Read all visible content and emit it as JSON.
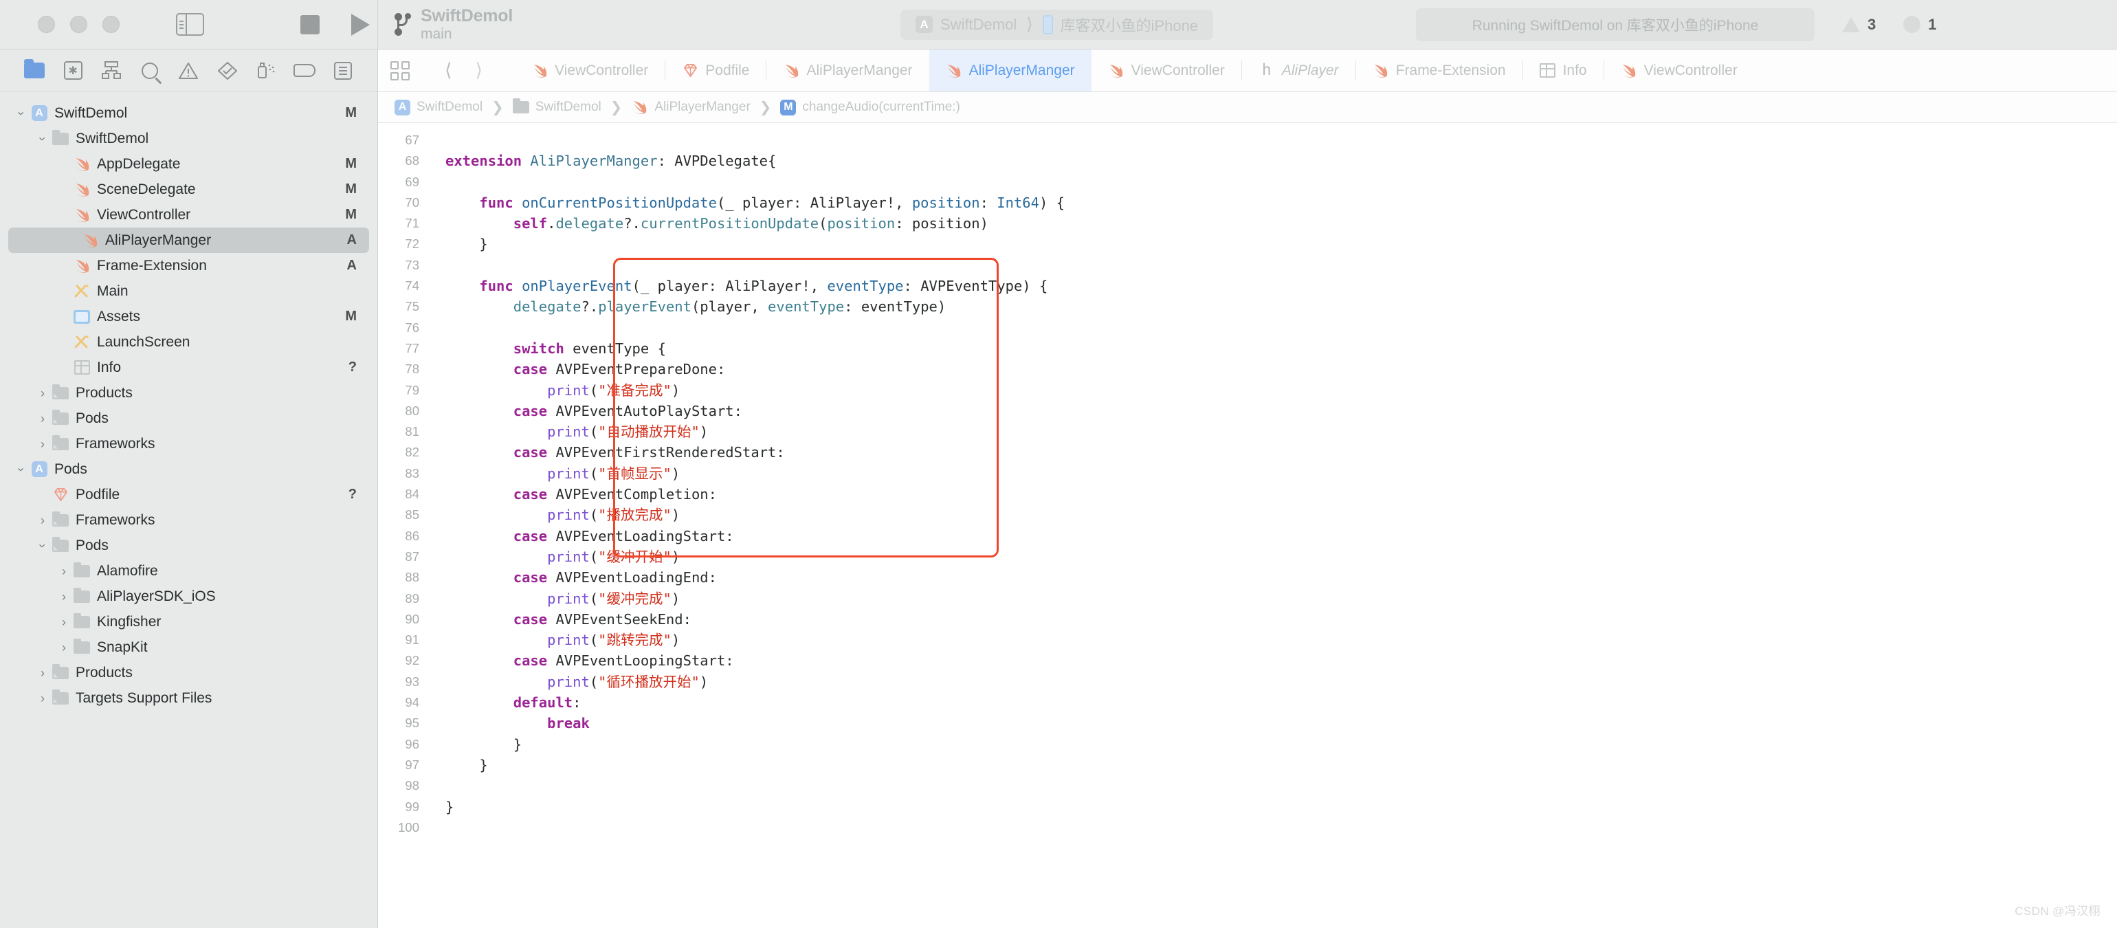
{
  "titlebar": {
    "project_name": "SwiftDemol",
    "branch": "main",
    "scheme_target": "SwiftDemol",
    "scheme_device": "库客双小鱼的iPhone",
    "status": "Running SwiftDemol on 库客双小鱼的iPhone",
    "warning_count": "3",
    "error_count": "1",
    "app_glyph": "A",
    "run_icon": "play-icon",
    "stop_icon": "stop-icon",
    "sidebar_icon": "sidebar-toggle-icon"
  },
  "navigator": {
    "toolbar_icons": [
      "project-navigator-icon",
      "source-control-navigator-icon",
      "symbol-navigator-icon",
      "find-navigator-icon",
      "issue-navigator-icon",
      "test-navigator-icon",
      "debug-navigator-icon",
      "breakpoint-navigator-icon",
      "report-navigator-icon"
    ],
    "items": [
      {
        "label": "SwiftDemol",
        "icon": "appstore-icon",
        "indent": 0,
        "twisty": "down",
        "mark": "M"
      },
      {
        "label": "SwiftDemol",
        "icon": "folder-icon",
        "indent": 1,
        "twisty": "down",
        "mark": ""
      },
      {
        "label": "AppDelegate",
        "icon": "swift-icon",
        "indent": 2,
        "twisty": "",
        "mark": "M"
      },
      {
        "label": "SceneDelegate",
        "icon": "swift-icon",
        "indent": 2,
        "twisty": "",
        "mark": "M"
      },
      {
        "label": "ViewController",
        "icon": "swift-icon",
        "indent": 2,
        "twisty": "",
        "mark": "M"
      },
      {
        "label": "AliPlayerManger",
        "icon": "swift-icon",
        "indent": 2,
        "twisty": "",
        "mark": "A",
        "selected": true
      },
      {
        "label": "Frame-Extension",
        "icon": "swift-icon",
        "indent": 2,
        "twisty": "",
        "mark": "A"
      },
      {
        "label": "Main",
        "icon": "storyboard-icon",
        "indent": 2,
        "twisty": "",
        "mark": ""
      },
      {
        "label": "Assets",
        "icon": "assets-icon",
        "indent": 2,
        "twisty": "",
        "mark": "M"
      },
      {
        "label": "LaunchScreen",
        "icon": "storyboard-icon",
        "indent": 2,
        "twisty": "",
        "mark": ""
      },
      {
        "label": "Info",
        "icon": "plist-icon",
        "indent": 2,
        "twisty": "",
        "mark": "?"
      },
      {
        "label": "Products",
        "icon": "folder-group-icon",
        "indent": 1,
        "twisty": "right",
        "mark": ""
      },
      {
        "label": "Pods",
        "icon": "folder-group-icon",
        "indent": 1,
        "twisty": "right",
        "mark": ""
      },
      {
        "label": "Frameworks",
        "icon": "folder-group-icon",
        "indent": 1,
        "twisty": "right",
        "mark": ""
      },
      {
        "label": "Pods",
        "icon": "appstore-icon",
        "indent": 0,
        "twisty": "down",
        "mark": ""
      },
      {
        "label": "Podfile",
        "icon": "ruby-icon",
        "indent": 1,
        "twisty": "",
        "mark": "?"
      },
      {
        "label": "Frameworks",
        "icon": "folder-group-icon",
        "indent": 1,
        "twisty": "right",
        "mark": ""
      },
      {
        "label": "Pods",
        "icon": "folder-group-icon",
        "indent": 1,
        "twisty": "down",
        "mark": ""
      },
      {
        "label": "Alamofire",
        "icon": "folder-icon",
        "indent": 2,
        "twisty": "right",
        "mark": ""
      },
      {
        "label": "AliPlayerSDK_iOS",
        "icon": "folder-icon",
        "indent": 2,
        "twisty": "right",
        "mark": ""
      },
      {
        "label": "Kingfisher",
        "icon": "folder-icon",
        "indent": 2,
        "twisty": "right",
        "mark": ""
      },
      {
        "label": "SnapKit",
        "icon": "folder-icon",
        "indent": 2,
        "twisty": "right",
        "mark": ""
      },
      {
        "label": "Products",
        "icon": "folder-group-icon",
        "indent": 1,
        "twisty": "right",
        "mark": ""
      },
      {
        "label": "Targets Support Files",
        "icon": "folder-group-icon",
        "indent": 1,
        "twisty": "right",
        "mark": ""
      }
    ]
  },
  "editor": {
    "layout_icon": "editor-layout-icon",
    "back_icon": "nav-back-icon",
    "forward_icon": "nav-forward-icon",
    "tabs": [
      {
        "label": "ViewController",
        "icon": "swift-icon",
        "active": false
      },
      {
        "label": "Podfile",
        "icon": "ruby-icon",
        "active": false
      },
      {
        "label": "AliPlayerManger",
        "icon": "swift-icon",
        "active": false
      },
      {
        "label": "AliPlayerManger",
        "icon": "swift-icon",
        "active": true
      },
      {
        "label": "ViewController",
        "icon": "swift-icon",
        "active": false
      },
      {
        "label": "AliPlayer",
        "icon": "header-icon",
        "active": false,
        "italic": true
      },
      {
        "label": "Frame-Extension",
        "icon": "swift-icon",
        "active": false
      },
      {
        "label": "Info",
        "icon": "plist-icon",
        "active": false
      },
      {
        "label": "ViewController",
        "icon": "swift-icon",
        "active": false
      }
    ],
    "breadcrumb": [
      {
        "label": "SwiftDemol",
        "icon": "appstore-icon"
      },
      {
        "label": "SwiftDemol",
        "icon": "folder-icon"
      },
      {
        "label": "AliPlayerManger",
        "icon": "swift-icon"
      },
      {
        "label": "changeAudio(currentTime:)",
        "icon": "method-badge"
      }
    ],
    "annotation_color": "#f0462a",
    "watermark": "CSDN @冯汉栩",
    "code_lines": [
      {
        "n": "67",
        "tokens": []
      },
      {
        "n": "68",
        "tokens": [
          {
            "t": "extension ",
            "c": "kw"
          },
          {
            "t": "AliPlayerManger",
            "c": "ty"
          },
          {
            "t": ": AVPDelegate{",
            "c": "pn"
          }
        ]
      },
      {
        "n": "69",
        "tokens": []
      },
      {
        "n": "70",
        "tokens": [
          {
            "t": "    ",
            "c": "pn"
          },
          {
            "t": "func ",
            "c": "kw"
          },
          {
            "t": "onCurrentPositionUpdate",
            "c": "fn"
          },
          {
            "t": "(_ player: AliPlayer!, ",
            "c": "pn"
          },
          {
            "t": "position",
            "c": "fn"
          },
          {
            "t": ": ",
            "c": "pn"
          },
          {
            "t": "Int64",
            "c": "fn"
          },
          {
            "t": ") {",
            "c": "pn"
          }
        ]
      },
      {
        "n": "71",
        "tokens": [
          {
            "t": "        ",
            "c": "pn"
          },
          {
            "t": "self",
            "c": "kw"
          },
          {
            "t": ".",
            "c": "pn"
          },
          {
            "t": "delegate",
            "c": "mth"
          },
          {
            "t": "?.",
            "c": "pn"
          },
          {
            "t": "currentPositionUpdate",
            "c": "mth"
          },
          {
            "t": "(",
            "c": "pn"
          },
          {
            "t": "position",
            "c": "mth"
          },
          {
            "t": ": position)",
            "c": "pn"
          }
        ]
      },
      {
        "n": "72",
        "tokens": [
          {
            "t": "    }",
            "c": "pn"
          }
        ]
      },
      {
        "n": "73",
        "tokens": []
      },
      {
        "n": "74",
        "tokens": [
          {
            "t": "    ",
            "c": "pn"
          },
          {
            "t": "func ",
            "c": "kw"
          },
          {
            "t": "onPlayerEvent",
            "c": "fn"
          },
          {
            "t": "(_ player: AliPlayer!, ",
            "c": "pn"
          },
          {
            "t": "eventType",
            "c": "fn"
          },
          {
            "t": ": AVPEventType) {",
            "c": "pn"
          }
        ]
      },
      {
        "n": "75",
        "tokens": [
          {
            "t": "        ",
            "c": "pn"
          },
          {
            "t": "delegate",
            "c": "mth"
          },
          {
            "t": "?.",
            "c": "pn"
          },
          {
            "t": "playerEvent",
            "c": "mth"
          },
          {
            "t": "(player, ",
            "c": "pn"
          },
          {
            "t": "eventType",
            "c": "mth"
          },
          {
            "t": ": eventType)",
            "c": "pn"
          }
        ]
      },
      {
        "n": "76",
        "tokens": []
      },
      {
        "n": "77",
        "tokens": [
          {
            "t": "        ",
            "c": "pn"
          },
          {
            "t": "switch",
            "c": "kw"
          },
          {
            "t": " eventType {",
            "c": "pn"
          }
        ]
      },
      {
        "n": "78",
        "tokens": [
          {
            "t": "        ",
            "c": "pn"
          },
          {
            "t": "case",
            "c": "kw"
          },
          {
            "t": " AVPEventPrepareDone:",
            "c": "pn"
          }
        ]
      },
      {
        "n": "79",
        "tokens": [
          {
            "t": "            ",
            "c": "pn"
          },
          {
            "t": "print",
            "c": "pl"
          },
          {
            "t": "(",
            "c": "pn"
          },
          {
            "t": "\"准备完成\"",
            "c": "str"
          },
          {
            "t": ")",
            "c": "pn"
          }
        ]
      },
      {
        "n": "80",
        "tokens": [
          {
            "t": "        ",
            "c": "pn"
          },
          {
            "t": "case",
            "c": "kw"
          },
          {
            "t": " AVPEventAutoPlayStart:",
            "c": "pn"
          }
        ]
      },
      {
        "n": "81",
        "tokens": [
          {
            "t": "            ",
            "c": "pn"
          },
          {
            "t": "print",
            "c": "pl"
          },
          {
            "t": "(",
            "c": "pn"
          },
          {
            "t": "\"自动播放开始\"",
            "c": "str"
          },
          {
            "t": ")",
            "c": "pn"
          }
        ]
      },
      {
        "n": "82",
        "tokens": [
          {
            "t": "        ",
            "c": "pn"
          },
          {
            "t": "case",
            "c": "kw"
          },
          {
            "t": " AVPEventFirstRenderedStart:",
            "c": "pn"
          }
        ]
      },
      {
        "n": "83",
        "tokens": [
          {
            "t": "            ",
            "c": "pn"
          },
          {
            "t": "print",
            "c": "pl"
          },
          {
            "t": "(",
            "c": "pn"
          },
          {
            "t": "\"首帧显示\"",
            "c": "str"
          },
          {
            "t": ")",
            "c": "pn"
          }
        ]
      },
      {
        "n": "84",
        "tokens": [
          {
            "t": "        ",
            "c": "pn"
          },
          {
            "t": "case",
            "c": "kw"
          },
          {
            "t": " AVPEventCompletion:",
            "c": "pn"
          }
        ]
      },
      {
        "n": "85",
        "tokens": [
          {
            "t": "            ",
            "c": "pn"
          },
          {
            "t": "print",
            "c": "pl"
          },
          {
            "t": "(",
            "c": "pn"
          },
          {
            "t": "\"播放完成\"",
            "c": "str"
          },
          {
            "t": ")",
            "c": "pn"
          }
        ]
      },
      {
        "n": "86",
        "tokens": [
          {
            "t": "        ",
            "c": "pn"
          },
          {
            "t": "case",
            "c": "kw"
          },
          {
            "t": " AVPEventLoadingStart:",
            "c": "pn"
          }
        ]
      },
      {
        "n": "87",
        "tokens": [
          {
            "t": "            ",
            "c": "pn"
          },
          {
            "t": "print",
            "c": "pl"
          },
          {
            "t": "(",
            "c": "pn"
          },
          {
            "t": "\"缓冲开始\"",
            "c": "str"
          },
          {
            "t": ")",
            "c": "pn"
          }
        ]
      },
      {
        "n": "88",
        "tokens": [
          {
            "t": "        ",
            "c": "pn"
          },
          {
            "t": "case",
            "c": "kw"
          },
          {
            "t": " AVPEventLoadingEnd:",
            "c": "pn"
          }
        ]
      },
      {
        "n": "89",
        "tokens": [
          {
            "t": "            ",
            "c": "pn"
          },
          {
            "t": "print",
            "c": "pl"
          },
          {
            "t": "(",
            "c": "pn"
          },
          {
            "t": "\"缓冲完成\"",
            "c": "str"
          },
          {
            "t": ")",
            "c": "pn"
          }
        ]
      },
      {
        "n": "90",
        "tokens": [
          {
            "t": "        ",
            "c": "pn"
          },
          {
            "t": "case",
            "c": "kw"
          },
          {
            "t": " AVPEventSeekEnd:",
            "c": "pn"
          }
        ]
      },
      {
        "n": "91",
        "tokens": [
          {
            "t": "            ",
            "c": "pn"
          },
          {
            "t": "print",
            "c": "pl"
          },
          {
            "t": "(",
            "c": "pn"
          },
          {
            "t": "\"跳转完成\"",
            "c": "str"
          },
          {
            "t": ")",
            "c": "pn"
          }
        ]
      },
      {
        "n": "92",
        "tokens": [
          {
            "t": "        ",
            "c": "pn"
          },
          {
            "t": "case",
            "c": "kw"
          },
          {
            "t": " AVPEventLoopingStart:",
            "c": "pn"
          }
        ]
      },
      {
        "n": "93",
        "tokens": [
          {
            "t": "            ",
            "c": "pn"
          },
          {
            "t": "print",
            "c": "pl"
          },
          {
            "t": "(",
            "c": "pn"
          },
          {
            "t": "\"循环播放开始\"",
            "c": "str"
          },
          {
            "t": ")",
            "c": "pn"
          }
        ]
      },
      {
        "n": "94",
        "tokens": [
          {
            "t": "        ",
            "c": "pn"
          },
          {
            "t": "default",
            "c": "kw"
          },
          {
            "t": ":",
            "c": "pn"
          }
        ]
      },
      {
        "n": "95",
        "tokens": [
          {
            "t": "            ",
            "c": "pn"
          },
          {
            "t": "break",
            "c": "kw"
          }
        ]
      },
      {
        "n": "96",
        "tokens": [
          {
            "t": "        }",
            "c": "pn"
          }
        ]
      },
      {
        "n": "97",
        "tokens": [
          {
            "t": "    }",
            "c": "pn"
          }
        ]
      },
      {
        "n": "98",
        "tokens": []
      },
      {
        "n": "99",
        "tokens": [
          {
            "t": "}",
            "c": "pn"
          }
        ]
      },
      {
        "n": "100",
        "tokens": []
      }
    ]
  }
}
